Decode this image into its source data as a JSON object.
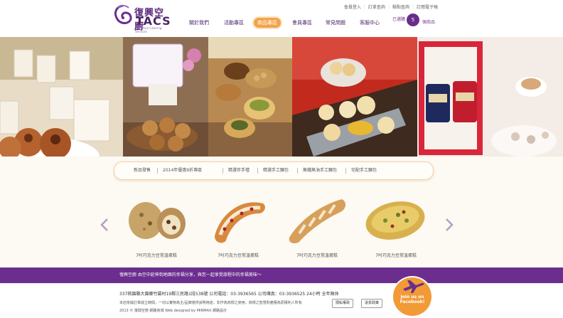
{
  "brand": {
    "name_cn": "復興空廚",
    "name_en": "TACS",
    "tagline": "TransAsia Catering Services"
  },
  "toplinks": [
    "會員登入",
    "訂單查詢",
    "積點查詢",
    "訂閱電子報"
  ],
  "nav": [
    {
      "label": "關於我們",
      "active": false
    },
    {
      "label": "活動專區",
      "active": false
    },
    {
      "label": "商品專區",
      "active": true
    },
    {
      "label": "會員專區",
      "active": false
    },
    {
      "label": "常見問題",
      "active": false
    },
    {
      "label": "客服中心",
      "active": false
    }
  ],
  "cart": {
    "prefix": "已選購",
    "count": "5",
    "suffix": "個商品"
  },
  "categories": [
    "新品發售",
    "2014年優惠9折專區",
    "精選伴手禮",
    "精選手工麵包",
    "無鐵無油手工麵包",
    "宅配手工麵包"
  ],
  "products": [
    {
      "caption": "7吋巧克力豆常溫蛋糕",
      "icon": "round-bread"
    },
    {
      "caption": "7吋巧克力豆常溫蛋糕",
      "icon": "cranberry-roll"
    },
    {
      "caption": "7吋巧克力豆常溫蛋糕",
      "icon": "twisted-bread"
    },
    {
      "caption": "7吋巧克力豆常溫蛋糕",
      "icon": "cheese-bread"
    }
  ],
  "slogan": "復興空廚 由空中延伸到地面的幸福分享，與您一起享受旅程中的幸福美味～",
  "footer": {
    "address": "337桃園縣大園鄉竹圍村19鄰三民路1段538號  公司電話：03-3936565  公司傳真：03-3936525  24小時 全年無休",
    "notice": "本店依據訂單成立時間，一切以實物為主/品牌僅供說明用途，非作為商標之使用，商標之智慧財產權為原權利人所有",
    "copyright": "2013 © 復興空廚 網路商城  Web designed by  MINMAX 網路設計",
    "btn_privacy": "隱私權政",
    "btn_return": "退貨政策"
  },
  "facebook": {
    "line1": "Join us on",
    "line2": "Facebook!"
  },
  "colors": {
    "brand_purple": "#6b2e8e",
    "accent_orange": "#f3a34a"
  }
}
